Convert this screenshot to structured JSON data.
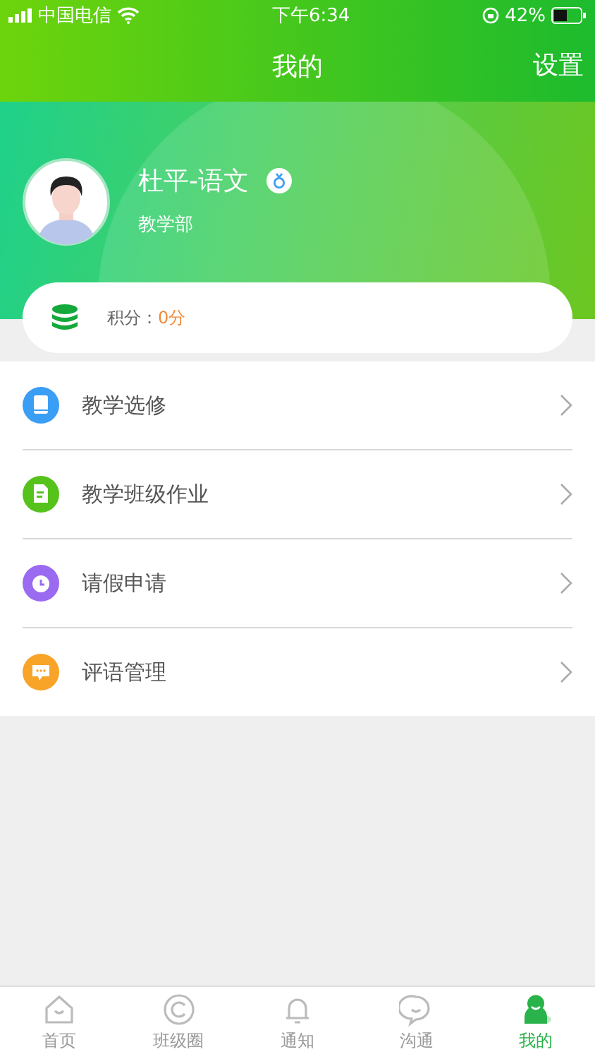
{
  "status_bar": {
    "carrier": "中国电信",
    "time": "下午6:34",
    "battery": "42%"
  },
  "nav_bar": {
    "title": "我的",
    "action": "设置"
  },
  "profile": {
    "name": "杜平-语文",
    "department": "教学部"
  },
  "points": {
    "label": "积分：",
    "value": "0分"
  },
  "menu": [
    {
      "label": "教学选修",
      "kind": "book",
      "color": "#3a9ef5"
    },
    {
      "label": "教学班级作业",
      "kind": "homework",
      "color": "#56c21c"
    },
    {
      "label": "请假申请",
      "kind": "clock",
      "color": "#9a6af0"
    },
    {
      "label": "评语管理",
      "kind": "comment",
      "color": "#f7a428"
    }
  ],
  "tab_bar": [
    {
      "label": "首页",
      "kind": "home",
      "selected": false
    },
    {
      "label": "班级圈",
      "kind": "circle",
      "selected": false
    },
    {
      "label": "通知",
      "kind": "bell",
      "selected": false
    },
    {
      "label": "沟通",
      "kind": "chat",
      "selected": false
    },
    {
      "label": "我的",
      "kind": "me",
      "selected": true
    }
  ]
}
